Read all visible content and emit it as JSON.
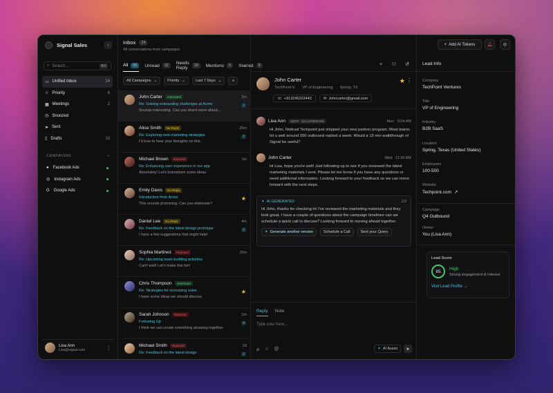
{
  "sidebar": {
    "brand": "Signal Sales",
    "search_placeholder": "Search...",
    "search_kbd": "⌘K",
    "items": [
      {
        "label": "Unified Inbox",
        "count": "24"
      },
      {
        "label": "Priority",
        "count": "6"
      },
      {
        "label": "Meetings",
        "count": "2"
      },
      {
        "label": "Snoozed",
        "count": ""
      },
      {
        "label": "Sent",
        "count": ""
      },
      {
        "label": "Drafts",
        "count": "10"
      }
    ],
    "campaigns_title": "CAMPAIGNS",
    "campaigns": [
      {
        "label": "Facebook Ads"
      },
      {
        "label": "Instagram Ads"
      },
      {
        "label": "Google Ads"
      }
    ],
    "user": {
      "name": "Lisa Ann",
      "email": "Lisa@signal.com"
    }
  },
  "inbox": {
    "title": "Inbox",
    "count": "24",
    "subtitle": "All conversations from campaigns",
    "tabs": [
      {
        "label": "All",
        "count": "56"
      },
      {
        "label": "Unread",
        "count": "32"
      },
      {
        "label": "Needs Reply",
        "count": "18"
      },
      {
        "label": "Mentions",
        "count": "5"
      },
      {
        "label": "Starred",
        "count": "9"
      }
    ],
    "filters": {
      "campaigns": "All Campaigns",
      "priority": "Priority",
      "range": "Last 7 Days"
    },
    "rows": [
      {
        "name": "John Carter",
        "tag": "Interested",
        "subject": "Re: Solving onboarding challenges at Acme",
        "preview": "Sounds interesting. Can you share more about....",
        "time": "2m",
        "count": "2"
      },
      {
        "name": "Alice Smith",
        "tag": "No Reply",
        "subject": "Re: Exploring new marketing strategies",
        "preview": "I'd love to hear your thoughts on this.",
        "time": "20m",
        "count": "3"
      },
      {
        "name": "Michael Brown",
        "tag": "Rejected",
        "subject": "Re: Enhancing user experience in our app",
        "preview": "Absolutely! Let's brainstorm some ideas.",
        "time": "1m",
        "count": ""
      },
      {
        "name": "Emily Davis",
        "tag": "No Reply",
        "subject": "Introduction from Acme",
        "preview": "This sounds promising. Can you elaborate?",
        "time": "",
        "count": ""
      },
      {
        "name": "Daniel Lee",
        "tag": "No Reply",
        "subject": "Re: Feedback on the latest design prototype",
        "preview": "I have a few suggestions that might help!",
        "time": "4m",
        "count": "2"
      },
      {
        "name": "Sophia Martinez",
        "tag": "Rejected",
        "subject": "Re: Upcoming team-building activities",
        "preview": "Can't wait! Let's make this fun!",
        "time": "22m",
        "count": ""
      },
      {
        "name": "Chris Thompson",
        "tag": "Interested",
        "subject": "Re: Strategies for increasing sales",
        "preview": "I have some ideas we should discuss.",
        "time": "",
        "count": ""
      },
      {
        "name": "Sarah Johnson",
        "tag": "Rejected",
        "subject": "Following Up",
        "preview": "I think we can create something amazing together.",
        "time": "1m",
        "count": "4"
      },
      {
        "name": "Michael Smith",
        "tag": "Rejected",
        "subject": "Re: Feedback on the latest design",
        "preview": "",
        "time": "2d",
        "count": "2"
      }
    ]
  },
  "conversation": {
    "name": "John Carter",
    "company": "TechPoint V.",
    "role": "VP of Engineering",
    "location": "Spring, TX",
    "phone": "+913245222443",
    "email": "Johncarter@gmail.com",
    "messages": [
      {
        "from": "Lisa Ann",
        "label": "SENT · Q4 OUTBOUND",
        "day": "Mon",
        "time": "9:04 AM",
        "body": "Hi John, Noticed Techpoint just shipped your new partner program. Most teams hit a  well around 200 outbound replied a week. Would a 15 min walkthrough of Signal be useful?"
      },
      {
        "from": "John Carter",
        "label": "",
        "day": "Wed",
        "time": "11:30 AM",
        "body": "Hi Lisa, hope you're well! Just following up to see if you reviewed the latest marketing materials I sent. Please let me know if you have any questions or need additional information. Looking forward to your feedback so we can move forward with the next steps."
      }
    ],
    "ai": {
      "label": "AI GENERATED",
      "page": "1/3",
      "body": "Hi John, thanks for checking in! I've reviewed the marketing materials and they look great. I have a couple of questions about the campaign timelines can we schedule a quick call to discuss? Looking forward to moving ahead together.",
      "generate": "Generate another version",
      "schedule": "Schedule a Call",
      "send": "Sent your Query"
    },
    "reply_tab": "Reply",
    "note_tab": "Note",
    "reply_placeholder": "Type your here...",
    "ai_assist": "AI Assist"
  },
  "lead": {
    "title": "Lead Info",
    "add_tokens": "Add AI Tokens",
    "fields": [
      {
        "k": "Company",
        "v": "TechPoint Ventures"
      },
      {
        "k": "Title",
        "v": "VP of Engineering"
      },
      {
        "k": "Industry",
        "v": "B2B SaaS"
      },
      {
        "k": "Location",
        "v": "Spring, Texas (United States)"
      },
      {
        "k": "Employees",
        "v": "100-500"
      },
      {
        "k": "Website",
        "v": "Techpoint.com"
      },
      {
        "k": "Campaign",
        "v": "Q4 Outbound"
      },
      {
        "k": "Owner",
        "v": "You (Lisa Ann)"
      }
    ],
    "score": {
      "title": "Lead Score",
      "value": "85",
      "level": "High",
      "desc": "Strong engagement & Interest",
      "link": "Visit Lead Profile"
    }
  },
  "colors": {
    "accent": "#3fc6d9",
    "interested": "#4fd17a",
    "no_reply": "#e4c53a",
    "rejected": "#e0575a"
  }
}
